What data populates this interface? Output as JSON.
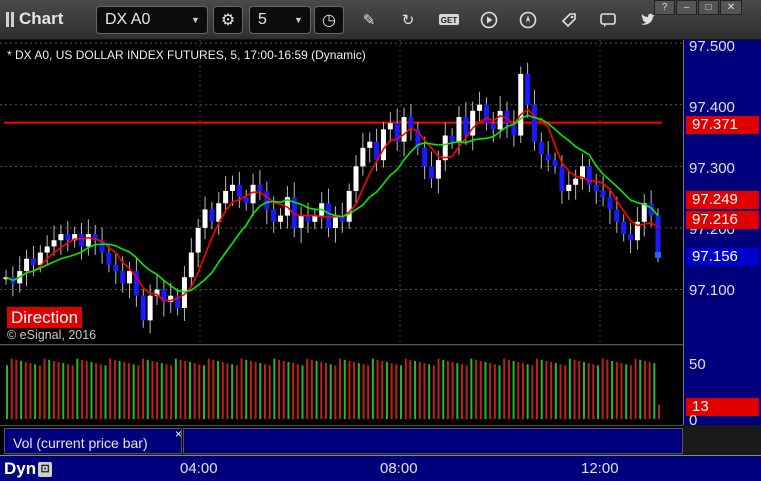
{
  "toolbar": {
    "app_title": "Chart",
    "symbol": "DX A0",
    "interval": "5",
    "icons": [
      "settings-gear-icon",
      "clock-icon",
      "pencil-icon",
      "refresh-icon",
      "get-icon",
      "play-icon",
      "compass-icon",
      "tag-icon",
      "comment-icon",
      "twitter-icon"
    ]
  },
  "window_buttons": [
    "help-icon",
    "minimize-icon",
    "maximize-icon",
    "close-icon"
  ],
  "chart": {
    "caption": "* DX A0, US DOLLAR INDEX FUTURES, 5, 17:00-16:59 (Dynamic)",
    "direction_label": "Direction",
    "copyright": "© eSignal, 2016",
    "price_ticks": [
      "97.500",
      "97.400",
      "97.300",
      "97.200",
      "97.100"
    ],
    "price_ticks_values": [
      97.5,
      97.4,
      97.3,
      97.2,
      97.1
    ],
    "price_labels": [
      {
        "text": "97.371",
        "value": 97.371,
        "color": "#e00000"
      },
      {
        "text": "97.249",
        "value": 97.249,
        "color": "#e00000"
      },
      {
        "text": "97.216",
        "value": 97.216,
        "color": "#e00000"
      },
      {
        "text": "97.156",
        "value": 97.156,
        "color": "#0000cc"
      }
    ],
    "colors": {
      "up": "#ffffff",
      "down": "#1a1aff",
      "ma_fast": "#ff0000",
      "ma_slow": "#00ee00",
      "level": "#ff0000",
      "axis_bg": "#00007d"
    }
  },
  "chart_data": {
    "type": "candlestick",
    "title": "* DX A0, US DOLLAR INDEX FUTURES, 5, 17:00-16:59 (Dynamic)",
    "ylim": [
      97.01,
      97.505
    ],
    "x_ticks": [
      "04:00",
      "08:00",
      "12:00"
    ],
    "horizontal_levels": [
      97.371
    ],
    "close_series": [
      97.12,
      97.11,
      97.13,
      97.15,
      97.14,
      97.16,
      97.17,
      97.18,
      97.19,
      97.18,
      97.19,
      97.17,
      97.19,
      97.18,
      97.16,
      97.14,
      97.13,
      97.11,
      97.13,
      97.09,
      97.05,
      97.09,
      97.1,
      97.08,
      97.09,
      97.07,
      97.12,
      97.16,
      97.2,
      97.23,
      97.21,
      97.24,
      97.26,
      97.27,
      97.25,
      97.24,
      97.27,
      97.26,
      97.23,
      97.21,
      97.22,
      97.25,
      97.2,
      97.22,
      97.21,
      97.22,
      97.24,
      97.2,
      97.22,
      97.21,
      97.26,
      97.3,
      97.33,
      97.34,
      97.31,
      97.36,
      97.37,
      97.34,
      97.38,
      97.36,
      97.33,
      97.3,
      97.28,
      97.31,
      97.35,
      97.34,
      97.38,
      97.35,
      97.39,
      97.4,
      97.37,
      97.36,
      97.39,
      97.37,
      97.35,
      97.45,
      97.4,
      97.34,
      97.32,
      97.31,
      97.3,
      97.26,
      97.27,
      97.28,
      97.3,
      97.27,
      97.26,
      97.25,
      97.23,
      97.21,
      97.19,
      97.18,
      97.21,
      97.24,
      97.22,
      97.156
    ],
    "volume_pane": {
      "ticks": [
        "50",
        "0"
      ],
      "current_label": "13",
      "legend": "Vol (current price bar)"
    }
  },
  "volume": {
    "legend": "Vol (current price bar)",
    "tick_50": "50",
    "tick_0": "0",
    "current_value": "13"
  },
  "time_axis": {
    "mode": "Dyn",
    "labels": [
      "04:00",
      "08:00",
      "12:00"
    ]
  }
}
